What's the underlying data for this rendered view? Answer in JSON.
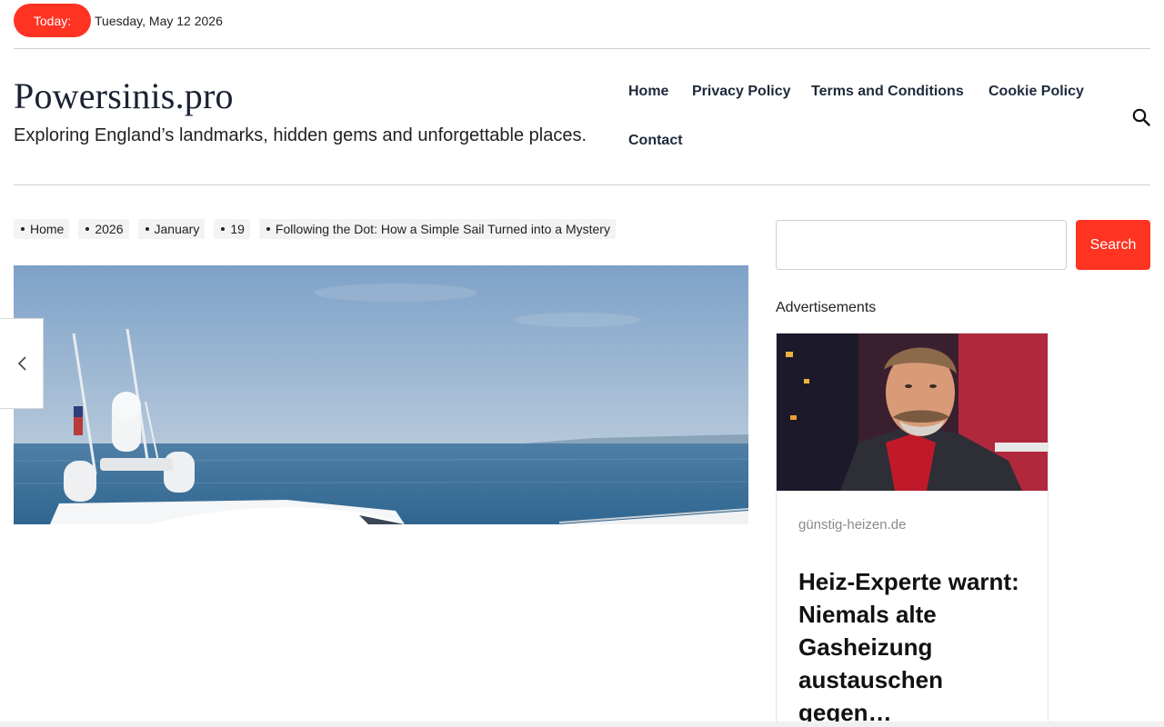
{
  "topbar": {
    "today_label": "Today:",
    "date": "Tuesday, May 12 2026"
  },
  "site": {
    "title": "Powersinis.pro",
    "tagline": "Exploring England’s landmarks, hidden gems and unforgettable places."
  },
  "nav": {
    "items": [
      "Home",
      "Privacy Policy",
      "Terms and Conditions",
      "Cookie Policy",
      "Contact"
    ]
  },
  "breadcrumb": {
    "items": [
      "Home",
      "2026",
      "January",
      "19",
      "Following the Dot: How a Simple Sail Turned into a Mystery"
    ]
  },
  "sidebar": {
    "search_value": "",
    "search_button": "Search",
    "ads_label": "Advertisements"
  },
  "ad": {
    "source": "günstig-heizen.de",
    "headline": "Heiz-Experte warnt: Niemals alte Gasheizung austauschen gegen…"
  },
  "colors": {
    "accent": "#ff3322",
    "nav_text": "#1e2a3a"
  },
  "icons": {
    "search": "search-icon",
    "previous": "chevron-left-icon"
  }
}
